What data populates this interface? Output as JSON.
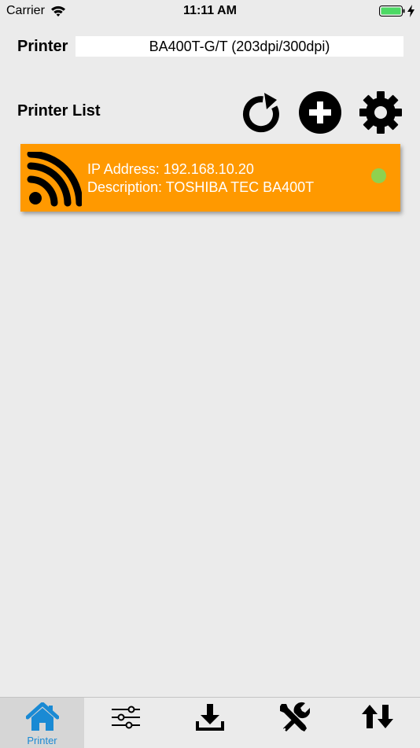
{
  "status_bar": {
    "carrier": "Carrier",
    "time": "11:11 AM",
    "icons": [
      "wifi-icon",
      "battery-icon",
      "charging-bolt-icon"
    ]
  },
  "printer": {
    "label": "Printer",
    "value": "BA400T-G/T (203dpi/300dpi)"
  },
  "printer_list": {
    "label": "Printer List",
    "toolbar": [
      "refresh-icon",
      "add-icon",
      "settings-icon"
    ],
    "items": [
      {
        "ip": "IP Address: 192.168.10.20",
        "description": "Description: TOSHIBA TEC BA400T",
        "icon": "wireless-icon",
        "status_color": "#8fd14f"
      }
    ]
  },
  "tab_bar": {
    "tabs": [
      {
        "icon": "home-icon",
        "label": "Printer",
        "selected": true
      },
      {
        "icon": "sliders-icon",
        "label": ""
      },
      {
        "icon": "download-icon",
        "label": ""
      },
      {
        "icon": "tools-icon",
        "label": ""
      },
      {
        "icon": "transfer-arrows-icon",
        "label": ""
      }
    ]
  },
  "colors": {
    "background": "#ebebeb",
    "card": "#ff9900",
    "accent": "#1a8ad4",
    "battery": "#4cd964"
  }
}
